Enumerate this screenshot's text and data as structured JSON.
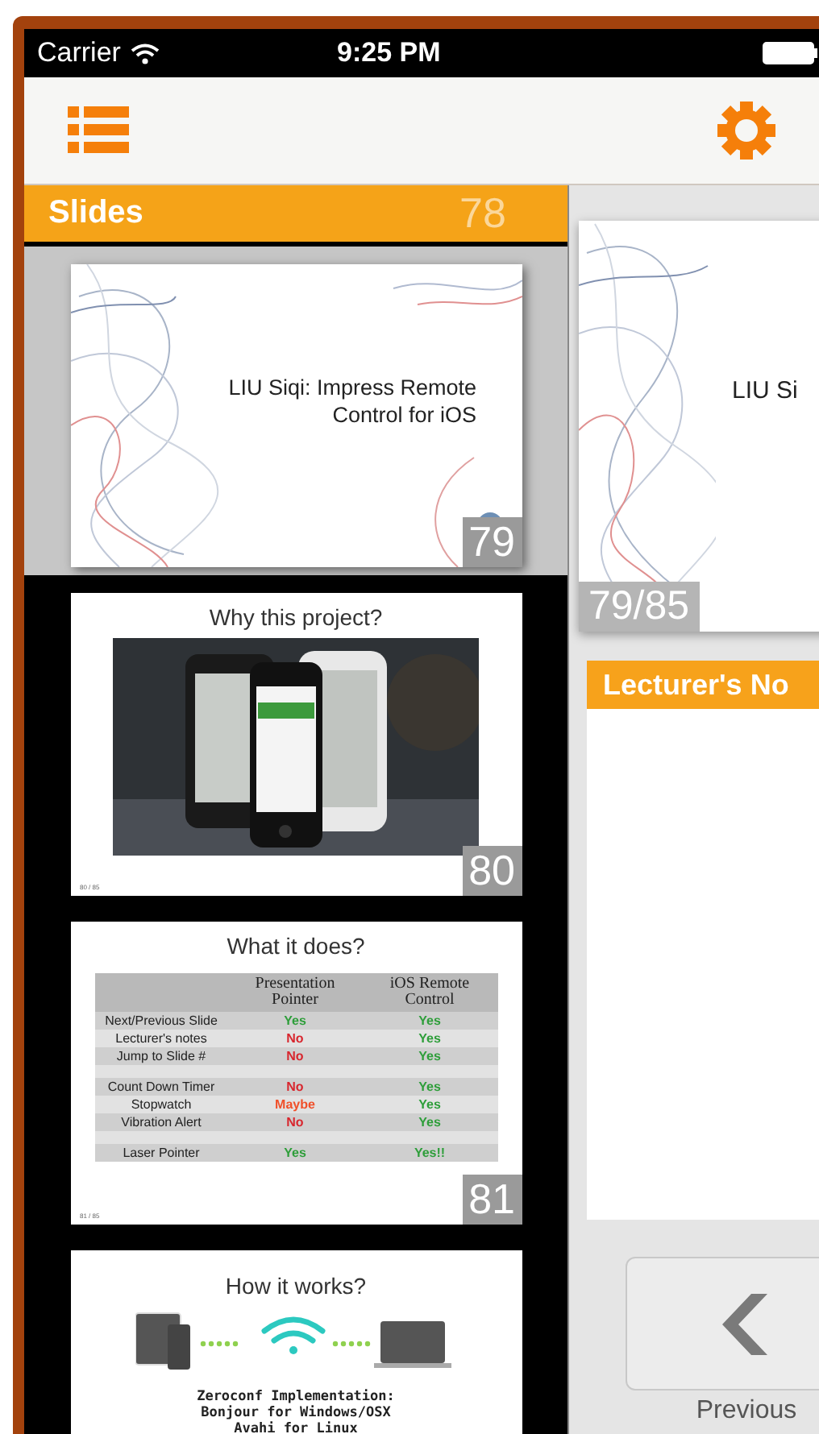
{
  "status_bar": {
    "carrier": "Carrier",
    "time": "9:25 PM"
  },
  "slides_panel": {
    "title": "Slides",
    "faded_number": "78",
    "slides": [
      {
        "kind": "title",
        "number": "79",
        "selected": true,
        "lines": [
          "LIU Siqi: Impress Remote",
          "Control for iOS"
        ]
      },
      {
        "number": "80",
        "selected": false,
        "title": "Why this project?",
        "footer": "80 / 85"
      },
      {
        "kind": "table",
        "number": "81",
        "selected": false,
        "title": "What it does?",
        "footer": "81 / 85",
        "columns": [
          "Presentation Pointer",
          "iOS Remote Control"
        ],
        "rows": [
          {
            "kind": "row",
            "label": "Next/Previous Slide",
            "cells": [
              {
                "text": "Yes",
                "color": "#2e9e3a"
              },
              {
                "text": "Yes",
                "color": "#2e9e3a"
              }
            ]
          },
          {
            "kind": "row",
            "label": "Lecturer's notes",
            "cells": [
              {
                "text": "No",
                "color": "#d8262e"
              },
              {
                "text": "Yes",
                "color": "#2e9e3a"
              }
            ]
          },
          {
            "kind": "row",
            "label": "Jump to Slide #",
            "cells": [
              {
                "text": "No",
                "color": "#d8262e"
              },
              {
                "text": "Yes",
                "color": "#2e9e3a"
              }
            ]
          },
          {
            "kind": "spacer"
          },
          {
            "kind": "row",
            "label": "Count Down Timer",
            "cells": [
              {
                "text": "No",
                "color": "#d8262e"
              },
              {
                "text": "Yes",
                "color": "#2e9e3a"
              }
            ]
          },
          {
            "kind": "row",
            "label": "Stopwatch",
            "cells": [
              {
                "text": "Maybe",
                "color": "#f0502a"
              },
              {
                "text": "Yes",
                "color": "#2e9e3a"
              }
            ]
          },
          {
            "kind": "row",
            "label": "Vibration Alert",
            "cells": [
              {
                "text": "No",
                "color": "#d8262e"
              },
              {
                "text": "Yes",
                "color": "#2e9e3a"
              }
            ]
          },
          {
            "kind": "spacer"
          },
          {
            "kind": "row",
            "label": "Laser Pointer",
            "cells": [
              {
                "text": "Yes",
                "color": "#2e9e3a"
              },
              {
                "text": "Yes!!",
                "color": "#2e9e3a"
              }
            ]
          }
        ]
      },
      {
        "kind": "diagram",
        "selected": false,
        "title": "How it works?",
        "lines": [
          "Zeroconf  Implementation:",
          "Bonjour  for  Windows/OSX",
          "Avahi  for  Linux"
        ]
      }
    ]
  },
  "preview": {
    "text": "LIU Si",
    "counter": "79/85"
  },
  "notes": {
    "title": "Lecturer's No"
  },
  "previous_button": {
    "label": "Previous"
  }
}
